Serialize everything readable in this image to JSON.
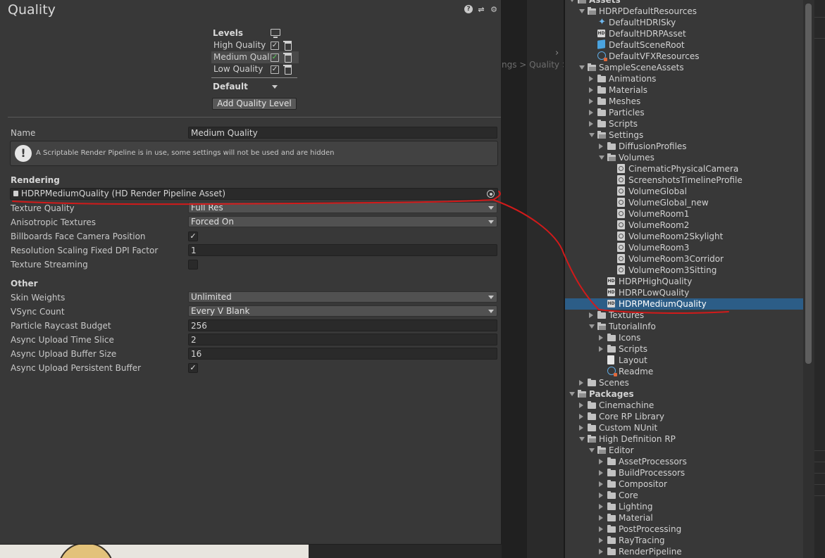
{
  "background": {
    "breadcrumb": "ngs > Quality > H"
  },
  "quality_window": {
    "title": "Quality",
    "header_icons": [
      "help-icon",
      "sliders-icon",
      "gear-icon"
    ],
    "levels_header": "Levels",
    "levels": [
      {
        "name": "High Quality",
        "checked": true,
        "selected": false
      },
      {
        "name": "Medium Quali",
        "checked": true,
        "selected": true
      },
      {
        "name": "Low Quality",
        "checked": true,
        "selected": false
      }
    ],
    "default_label": "Default",
    "add_button": "Add Quality Level",
    "name_label": "Name",
    "name_value": "Medium Quality",
    "help_message": "A Scriptable Render Pipeline is in use, some settings will not be used and are hidden",
    "rendering_title": "Rendering",
    "render_pipeline_asset": "HDRPMediumQuality (HD Render Pipeline Asset)",
    "rendering_props": {
      "texture_quality": {
        "label": "Texture Quality",
        "value": "Full Res"
      },
      "anisotropic": {
        "label": "Anisotropic Textures",
        "value": "Forced On"
      },
      "billboards": {
        "label": "Billboards Face Camera Position",
        "checked": true
      },
      "dpi_factor": {
        "label": "Resolution Scaling Fixed DPI Factor",
        "value": "1"
      },
      "texture_streaming": {
        "label": "Texture Streaming",
        "checked": false
      }
    },
    "other_title": "Other",
    "other_props": {
      "skin_weights": {
        "label": "Skin Weights",
        "value": "Unlimited"
      },
      "vsync": {
        "label": "VSync Count",
        "value": "Every V Blank"
      },
      "raycast_budget": {
        "label": "Particle Raycast Budget",
        "value": "256"
      },
      "upload_time_slice": {
        "label": "Async Upload Time Slice",
        "value": "2"
      },
      "upload_buffer_size": {
        "label": "Async Upload Buffer Size",
        "value": "16"
      },
      "persistent_buffer": {
        "label": "Async Upload Persistent Buffer",
        "checked": true
      }
    }
  },
  "project": {
    "items": [
      {
        "label": "Assets",
        "icon": "folder-open",
        "depth": 0,
        "arrow": "down",
        "bold": true
      },
      {
        "label": "HDRPDefaultResources",
        "icon": "folder-open",
        "depth": 1,
        "arrow": "down"
      },
      {
        "label": "DefaultHDRISky",
        "icon": "sky",
        "depth": 2,
        "arrow": "none"
      },
      {
        "label": "DefaultHDRPAsset",
        "icon": "hd",
        "depth": 2,
        "arrow": "none"
      },
      {
        "label": "DefaultSceneRoot",
        "icon": "cube",
        "depth": 2,
        "arrow": "none"
      },
      {
        "label": "DefaultVFXResources",
        "icon": "vfx",
        "depth": 2,
        "arrow": "none"
      },
      {
        "label": "SampleSceneAssets",
        "icon": "folder-open",
        "depth": 1,
        "arrow": "down"
      },
      {
        "label": "Animations",
        "icon": "folder",
        "depth": 2,
        "arrow": "right"
      },
      {
        "label": "Materials",
        "icon": "folder",
        "depth": 2,
        "arrow": "right"
      },
      {
        "label": "Meshes",
        "icon": "folder",
        "depth": 2,
        "arrow": "right"
      },
      {
        "label": "Particles",
        "icon": "folder",
        "depth": 2,
        "arrow": "right"
      },
      {
        "label": "Scripts",
        "icon": "folder",
        "depth": 2,
        "arrow": "right"
      },
      {
        "label": "Settings",
        "icon": "folder-open",
        "depth": 2,
        "arrow": "down"
      },
      {
        "label": "DiffusionProfiles",
        "icon": "folder",
        "depth": 3,
        "arrow": "right"
      },
      {
        "label": "Volumes",
        "icon": "folder-open",
        "depth": 3,
        "arrow": "down"
      },
      {
        "label": "CinematicPhysicalCamera",
        "icon": "volume",
        "depth": 4,
        "arrow": "none"
      },
      {
        "label": "ScreenshotsTimelineProfile",
        "icon": "volume",
        "depth": 4,
        "arrow": "none"
      },
      {
        "label": "VolumeGlobal",
        "icon": "volume",
        "depth": 4,
        "arrow": "none"
      },
      {
        "label": "VolumeGlobal_new",
        "icon": "volume",
        "depth": 4,
        "arrow": "none"
      },
      {
        "label": "VolumeRoom1",
        "icon": "volume",
        "depth": 4,
        "arrow": "none"
      },
      {
        "label": "VolumeRoom2",
        "icon": "volume",
        "depth": 4,
        "arrow": "none"
      },
      {
        "label": "VolumeRoom2Skylight",
        "icon": "volume",
        "depth": 4,
        "arrow": "none"
      },
      {
        "label": "VolumeRoom3",
        "icon": "volume",
        "depth": 4,
        "arrow": "none"
      },
      {
        "label": "VolumeRoom3Corridor",
        "icon": "volume",
        "depth": 4,
        "arrow": "none"
      },
      {
        "label": "VolumeRoom3Sitting",
        "icon": "volume",
        "depth": 4,
        "arrow": "none"
      },
      {
        "label": "HDRPHighQuality",
        "icon": "hd",
        "depth": 3,
        "arrow": "none"
      },
      {
        "label": "HDRPLowQuality",
        "icon": "hd",
        "depth": 3,
        "arrow": "none"
      },
      {
        "label": "HDRPMediumQuality",
        "icon": "hd",
        "depth": 3,
        "arrow": "none",
        "selected": true
      },
      {
        "label": "Textures",
        "icon": "folder",
        "depth": 2,
        "arrow": "right"
      },
      {
        "label": "TutorialInfo",
        "icon": "folder-open",
        "depth": 2,
        "arrow": "down"
      },
      {
        "label": "Icons",
        "icon": "folder",
        "depth": 3,
        "arrow": "right"
      },
      {
        "label": "Scripts",
        "icon": "folder",
        "depth": 3,
        "arrow": "right"
      },
      {
        "label": "Layout",
        "icon": "doc",
        "depth": 3,
        "arrow": "none"
      },
      {
        "label": "Readme",
        "icon": "readme",
        "depth": 3,
        "arrow": "none"
      },
      {
        "label": "Scenes",
        "icon": "folder",
        "depth": 1,
        "arrow": "right"
      },
      {
        "label": "Packages",
        "icon": "folder-open",
        "depth": 0,
        "arrow": "down",
        "bold": true
      },
      {
        "label": "Cinemachine",
        "icon": "folder",
        "depth": 1,
        "arrow": "right"
      },
      {
        "label": "Core RP Library",
        "icon": "folder",
        "depth": 1,
        "arrow": "right"
      },
      {
        "label": "Custom NUnit",
        "icon": "folder",
        "depth": 1,
        "arrow": "right"
      },
      {
        "label": "High Definition RP",
        "icon": "folder-open",
        "depth": 1,
        "arrow": "down"
      },
      {
        "label": "Editor",
        "icon": "folder-open",
        "depth": 2,
        "arrow": "down"
      },
      {
        "label": "AssetProcessors",
        "icon": "folder",
        "depth": 3,
        "arrow": "right"
      },
      {
        "label": "BuildProcessors",
        "icon": "folder",
        "depth": 3,
        "arrow": "right"
      },
      {
        "label": "Compositor",
        "icon": "folder",
        "depth": 3,
        "arrow": "right"
      },
      {
        "label": "Core",
        "icon": "folder",
        "depth": 3,
        "arrow": "right"
      },
      {
        "label": "Lighting",
        "icon": "folder",
        "depth": 3,
        "arrow": "right"
      },
      {
        "label": "Material",
        "icon": "folder",
        "depth": 3,
        "arrow": "right"
      },
      {
        "label": "PostProcessing",
        "icon": "folder",
        "depth": 3,
        "arrow": "right"
      },
      {
        "label": "RayTracing",
        "icon": "folder",
        "depth": 3,
        "arrow": "right"
      },
      {
        "label": "RenderPipeline",
        "icon": "folder",
        "depth": 3,
        "arrow": "right"
      }
    ]
  },
  "colors": {
    "annotation": "#d21a1a",
    "selection": "#2c5d87"
  }
}
